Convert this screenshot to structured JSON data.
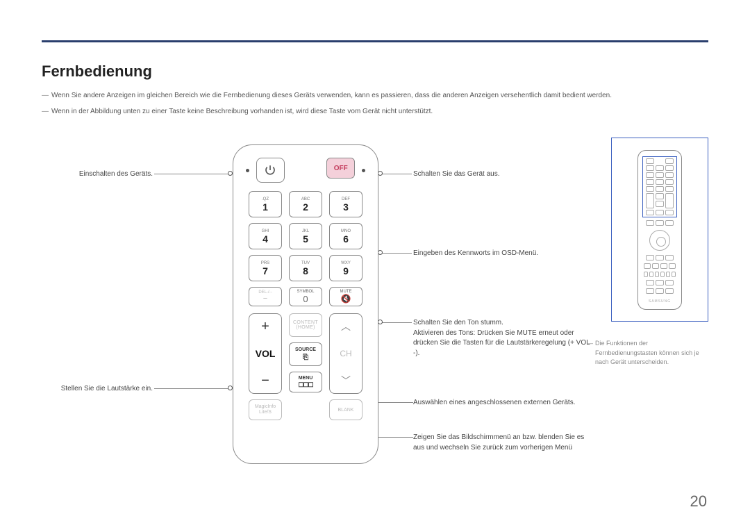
{
  "title": "Fernbedienung",
  "intro_notes": [
    "Wenn Sie andere Anzeigen im gleichen Bereich wie die Fernbedienung dieses Geräts verwenden, kann es passieren, dass die anderen Anzeigen versehentlich damit bedient werden.",
    "Wenn in der Abbildung unten zu einer Taste keine Beschreibung vorhanden ist, wird diese Taste vom Gerät nicht unterstützt."
  ],
  "remote": {
    "off_label": "OFF",
    "keypad_sup": [
      ".QZ",
      "ABC",
      "DEF",
      "GHI",
      "JKL",
      "MNO",
      "PRS",
      "TUV",
      "WXY"
    ],
    "keypad_digits": [
      "1",
      "2",
      "3",
      "4",
      "5",
      "6",
      "7",
      "8",
      "9"
    ],
    "row4": {
      "del": "DEL-/--",
      "symbol_sup": "SYMBOL",
      "symbol_digit": "0",
      "mute_sup": "MUTE"
    },
    "vol_label": "VOL",
    "ch_label": "CH",
    "content_l1": "CONTENT",
    "content_l2": "(HOME)",
    "source_label": "SOURCE",
    "menu_label": "MENU",
    "magicinfo_l1": "MagicInfo",
    "magicinfo_l2": "Lite/S",
    "blank_label": "BLANK"
  },
  "callouts": {
    "left_power": "Einschalten des Geräts.",
    "left_vol": "Stellen Sie die Lautstärke ein.",
    "right_off": "Schalten Sie das Gerät aus.",
    "right_keypad": "Eingeben des Kennworts im OSD-Menü.",
    "right_mute": "Schalten Sie den Ton stumm.\nAktivieren des Tons: Drücken Sie MUTE erneut oder drücken Sie die Tasten für die Lautstärkeregelung (+ VOL -).",
    "right_source": "Auswählen eines angeschlossenen externen Geräts.",
    "right_menu": "Zeigen Sie das Bildschirmmenü an bzw. blenden Sie es aus und wechseln Sie zurück zum vorherigen Menü"
  },
  "side_note": "Die Funktionen der Fernbedienungstasten können sich je nach Gerät unterscheiden.",
  "brand": "SAMSUNG",
  "page_number": "20"
}
